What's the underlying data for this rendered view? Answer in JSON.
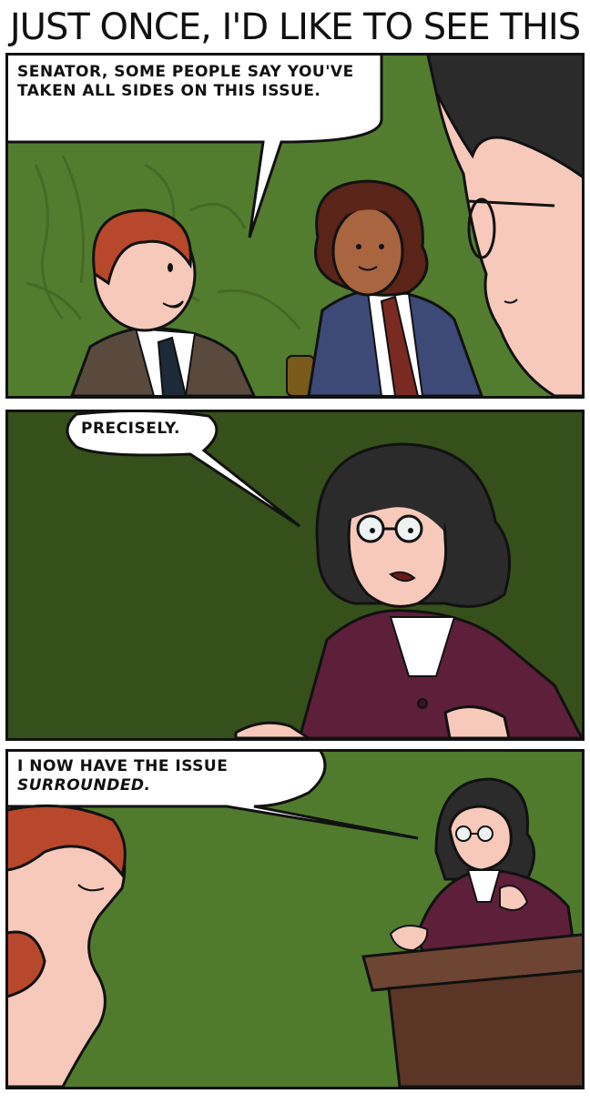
{
  "comic": {
    "title": "JUST ONCE, I'D LIKE TO SEE THIS"
  },
  "panel1": {
    "speech": "SENATOR, SOME PEOPLE SAY YOU'VE TAKEN ALL SIDES ON THIS ISSUE."
  },
  "panel2": {
    "speech": "PRECISELY."
  },
  "panel3": {
    "speech_line1": "I NOW HAVE THE ISSUE",
    "speech_line2": "SURROUNDED."
  },
  "colors": {
    "panel1_bg": "#537d2e",
    "panel2_bg": "#35501a",
    "panel3_bg": "#517b2c",
    "senator_jacket": "#5e1f3a",
    "skin_light": "#f7c9ba",
    "skin_dark": "#a9653f",
    "hair_red": "#b8482b",
    "hair_dark": "#2b2b2b"
  }
}
